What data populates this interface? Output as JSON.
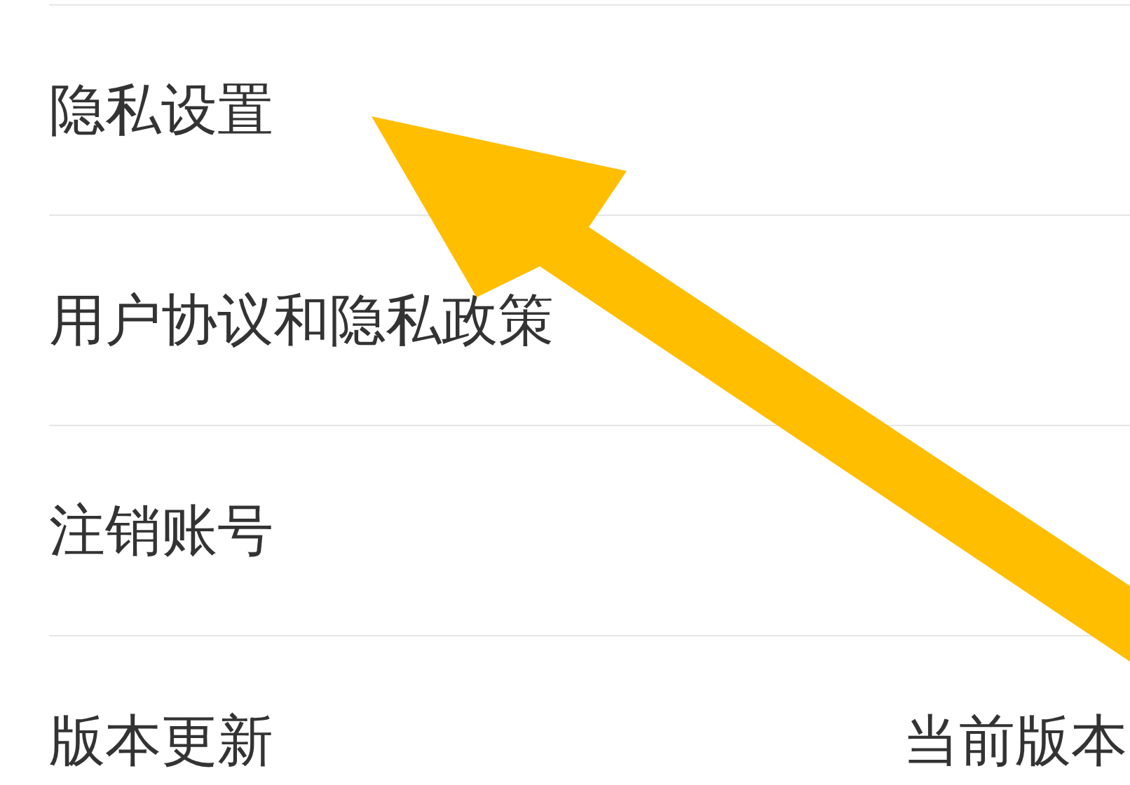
{
  "settings_items": [
    {
      "label": "隐私设置"
    },
    {
      "label": "用户协议和隐私政策"
    },
    {
      "label": "注销账号"
    },
    {
      "label": "版本更新",
      "value": "当前版本"
    }
  ]
}
